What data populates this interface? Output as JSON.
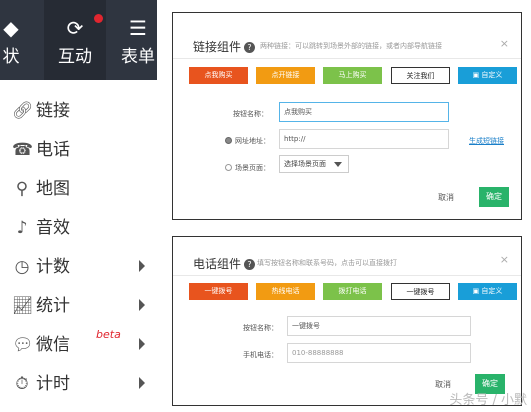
{
  "sidebar": {
    "tabs": [
      {
        "icon": "shape-icon",
        "label": "状"
      },
      {
        "icon": "refresh-icon",
        "label": "互动"
      },
      {
        "icon": "list-icon",
        "label": "表单"
      }
    ],
    "items": [
      {
        "icon": "link-icon",
        "label": "链接",
        "submenu": false
      },
      {
        "icon": "phone-icon",
        "label": "电话",
        "submenu": false
      },
      {
        "icon": "map-pin-icon",
        "label": "地图",
        "submenu": false
      },
      {
        "icon": "sound-icon",
        "label": "音效",
        "submenu": false
      },
      {
        "icon": "clock-icon",
        "label": "计数",
        "submenu": true
      },
      {
        "icon": "chart-icon",
        "label": "统计",
        "submenu": true
      },
      {
        "icon": "wechat-icon",
        "label": "微信",
        "badge": "beta",
        "submenu": true
      },
      {
        "icon": "timer-icon",
        "label": "计时",
        "submenu": true
      }
    ]
  },
  "link_dialog": {
    "title": "链接组件",
    "description": "两种链接：可以跳转到场景外部的链接，或者内部导航链接",
    "close": "×",
    "tabs": [
      "点我购买",
      "点开链接",
      "马上购买",
      "关注我们",
      "自定义"
    ],
    "button_name_label": "按钮名称：",
    "button_name_value": "点我购买",
    "url_label": "网址地址：",
    "url_value": "http://",
    "short_link": "生成短链接",
    "scene_page_label": "场景页面：",
    "scene_page_select": "选择场景页面",
    "cancel": "取消",
    "confirm": "确定"
  },
  "phone_dialog": {
    "title": "电话组件",
    "description": "填写按钮名称和联系号码，点击可以直接拨打",
    "close": "×",
    "tabs": [
      "一键拨号",
      "热线电话",
      "拨打电话",
      "一键拨号",
      "自定义"
    ],
    "button_name_label": "按钮名称：",
    "button_name_value": "一键拨号",
    "phone_label": "手机电话：",
    "phone_placeholder": "010-88888888",
    "cancel": "取消",
    "confirm": "确定"
  },
  "watermark": "头条号 / 小默",
  "colors": {
    "red": "#e8541e",
    "orange": "#f29b12",
    "green": "#7cc24a",
    "blue": "#199ed8",
    "confirm": "#29b36a",
    "sidebar": "#2f3540",
    "badge": "#e0262f"
  }
}
